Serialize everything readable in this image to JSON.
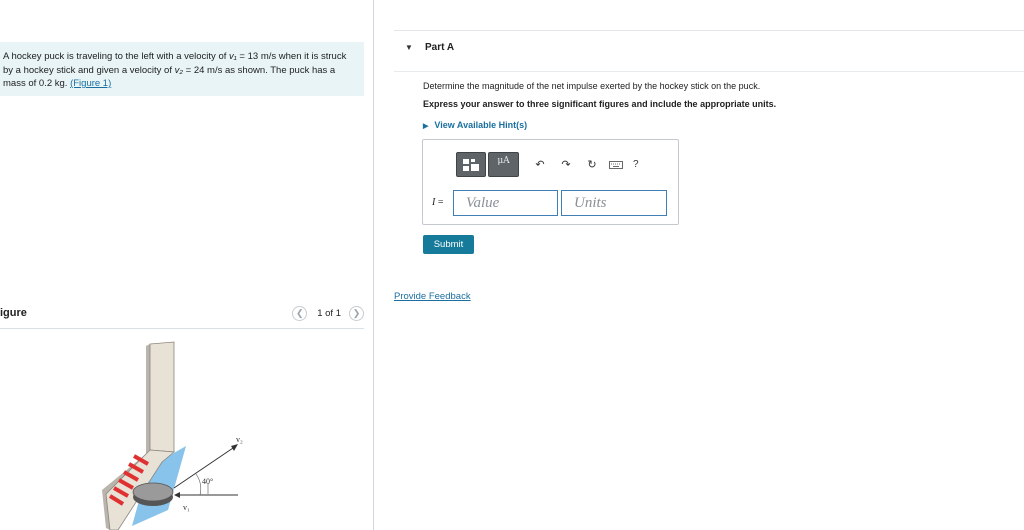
{
  "problem": {
    "text_before": "A hockey puck is traveling to the left with a velocity of ",
    "v1_sym": "v₁",
    "eq1": " = 13 ",
    "unit1": "m/s",
    "text_mid": " when it is struck by a hockey stick and given a velocity of ",
    "v2_sym": "v₂",
    "eq2": " = 24 ",
    "unit2": "m/s",
    "text_after": " as shown. The puck has a mass of 0.2 ",
    "mass_unit": "kg",
    "period": ". ",
    "figure_link": "(Figure 1)"
  },
  "figure_panel": {
    "title": "igure",
    "pager_text": "1 of 1",
    "labels": {
      "v2": "v₂",
      "v1": "v₁",
      "angle": "40°"
    }
  },
  "part": {
    "label": "Part A"
  },
  "question": {
    "line1": "Determine the magnitude of the net impulse exerted by the hockey stick on the puck.",
    "line2": "Express your answer to three significant figures and include the appropriate units."
  },
  "hint_label": "View Available Hint(s)",
  "toolbar": {
    "unit_button": "μA",
    "help": "?"
  },
  "answer": {
    "variable": "I",
    "equals": " =",
    "value_placeholder": "Value",
    "units_placeholder": "Units"
  },
  "submit_label": "Submit",
  "feedback_label": "Provide Feedback",
  "colors": {
    "accent": "#167a9a",
    "link": "#1a6fa0",
    "problem_bg": "#e8f4f6"
  }
}
